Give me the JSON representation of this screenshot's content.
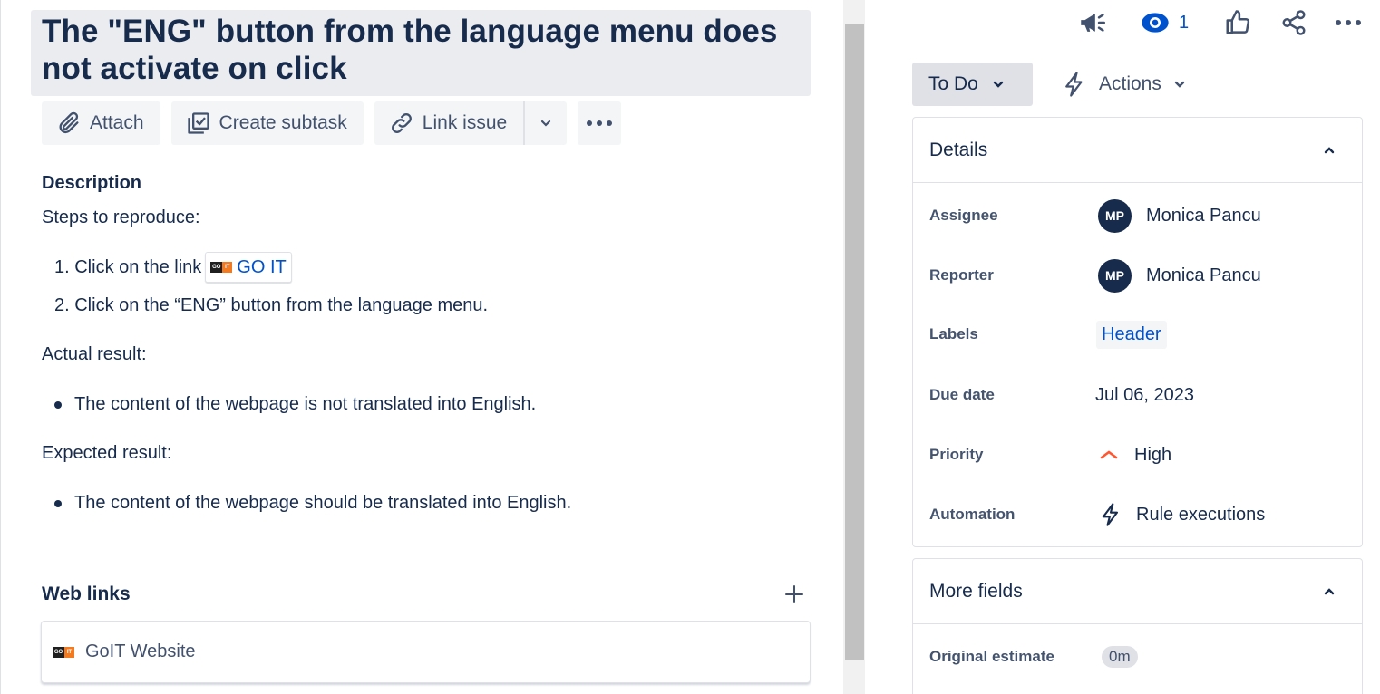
{
  "issue": {
    "title": "The \"ENG\" button from the language menu does not activate on click"
  },
  "toolbar": {
    "attach_label": "Attach",
    "create_subtask_label": "Create subtask",
    "link_issue_label": "Link issue"
  },
  "description": {
    "heading": "Description",
    "steps_intro": "Steps to reproduce:",
    "step1_prefix": "1. Click on the link",
    "step1_link": "GO IT",
    "step2": "2. Click on the “ENG” button from the language menu.",
    "actual_heading": "Actual result:",
    "actual_item": "The content of the webpage is not translated into English.",
    "expected_heading": "Expected result:",
    "expected_item": "The content of the webpage should be translated into English."
  },
  "web_links": {
    "heading": "Web links",
    "items": [
      {
        "title": "GoIT Website"
      }
    ]
  },
  "header_actions": {
    "watchers_count": "1",
    "icons": [
      "megaphone-icon",
      "eye-icon",
      "thumbs-up-icon",
      "share-icon",
      "more-icon"
    ]
  },
  "status": {
    "label": "To Do",
    "actions_label": "Actions"
  },
  "details": {
    "heading": "Details",
    "assignee_label": "Assignee",
    "assignee_initials": "MP",
    "assignee_name": "Monica Pancu",
    "reporter_label": "Reporter",
    "reporter_initials": "MP",
    "reporter_name": "Monica Pancu",
    "labels_label": "Labels",
    "labels_value": "Header",
    "due_date_label": "Due date",
    "due_date_value": "Jul 06, 2023",
    "priority_label": "Priority",
    "priority_value": "High",
    "automation_label": "Automation",
    "automation_value": "Rule executions"
  },
  "more_fields": {
    "heading": "More fields",
    "original_estimate_label": "Original estimate",
    "original_estimate_value": "0m"
  },
  "colors": {
    "text": "#172b4d",
    "link": "#0052cc",
    "priority_high": "#ff5630"
  }
}
